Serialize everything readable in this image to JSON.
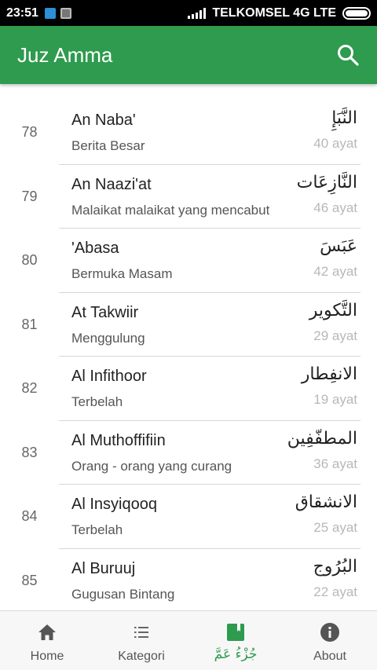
{
  "status_bar": {
    "time": "23:51",
    "carrier": "TELKOMSEL 4G LTE"
  },
  "app_bar": {
    "title": "Juz Amma",
    "action_icon": "search-icon"
  },
  "surahs": [
    {
      "number": "78",
      "name": "An Naba'",
      "meaning": "Berita Besar",
      "arabic": "النَّبَإِ",
      "ayat": "40 ayat"
    },
    {
      "number": "79",
      "name": "An Naazi'at",
      "meaning": "Malaikat malaikat yang mencabut",
      "arabic": "النَّازِعَات",
      "ayat": "46 ayat"
    },
    {
      "number": "80",
      "name": "'Abasa",
      "meaning": "Bermuka Masam",
      "arabic": "عَبَسَ",
      "ayat": "42 ayat"
    },
    {
      "number": "81",
      "name": "At Takwiir",
      "meaning": "Menggulung",
      "arabic": "التَّكوير",
      "ayat": "29 ayat"
    },
    {
      "number": "82",
      "name": "Al Infithoor",
      "meaning": "Terbelah",
      "arabic": "الانفِطار",
      "ayat": "19 ayat"
    },
    {
      "number": "83",
      "name": "Al Muthoffifiin",
      "meaning": "Orang - orang yang curang",
      "arabic": "المطفّفِين",
      "ayat": "36 ayat"
    },
    {
      "number": "84",
      "name": "Al Insyiqooq",
      "meaning": "Terbelah",
      "arabic": "الانشقاق",
      "ayat": "25 ayat"
    },
    {
      "number": "85",
      "name": "Al Buruuj",
      "meaning": "Gugusan Bintang",
      "arabic": "البُرُوج",
      "ayat": "22 ayat"
    }
  ],
  "bottom_nav": {
    "home": "Home",
    "kategori": "Kategori",
    "juz_amma": "جُزْءُ عَمَّ",
    "about": "About"
  },
  "colors": {
    "primary": "#2e9b4f",
    "status_bar": "#000000",
    "ayat_text": "#b8b8b8"
  }
}
